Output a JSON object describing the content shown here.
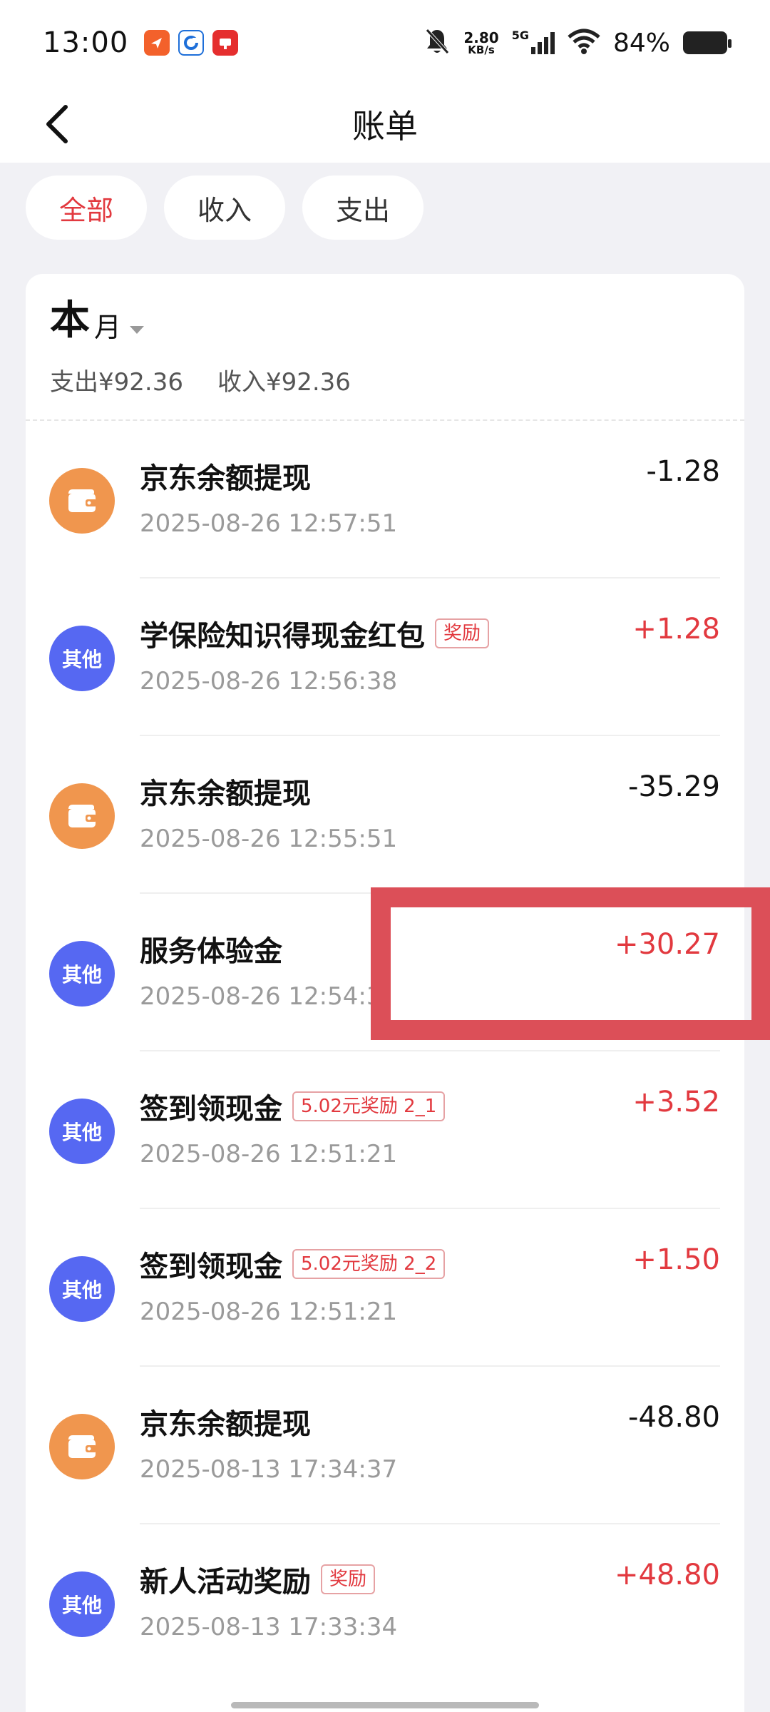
{
  "status_bar": {
    "time": "13:00",
    "net_speed_value": "2.80",
    "net_speed_unit": "KB/s",
    "signal_label": "5G",
    "battery_percent": "84%",
    "battery_level": 0.84,
    "icons": [
      "app-badge-orange",
      "app-badge-blue",
      "app-badge-red",
      "bell-muted-icon",
      "signal-icon",
      "wifi-icon",
      "battery-icon"
    ]
  },
  "header": {
    "title": "账单",
    "back_icon": "chevron-left-icon"
  },
  "filters": {
    "tabs": [
      {
        "label": "全部",
        "active": true
      },
      {
        "label": "收入",
        "active": false
      },
      {
        "label": "支出",
        "active": false
      }
    ]
  },
  "month": {
    "big": "本",
    "small": "月",
    "expense_label": "支出¥92.36",
    "income_label": "收入¥92.36"
  },
  "transactions": [
    {
      "icon": "wallet",
      "icon_text": "",
      "title": "京东余额提现",
      "tag": "",
      "time": "2025-08-26 12:57:51",
      "amount": "-1.28",
      "sign": "neg"
    },
    {
      "icon": "other",
      "icon_text": "其他",
      "title": "学保险知识得现金红包",
      "tag": "奖励",
      "time": "2025-08-26 12:56:38",
      "amount": "+1.28",
      "sign": "pos"
    },
    {
      "icon": "wallet",
      "icon_text": "",
      "title": "京东余额提现",
      "tag": "",
      "time": "2025-08-26 12:55:51",
      "amount": "-35.29",
      "sign": "neg"
    },
    {
      "icon": "other",
      "icon_text": "其他",
      "title": "服务体验金",
      "tag": "",
      "time": "2025-08-26 12:54:3",
      "amount": "+30.27",
      "sign": "pos"
    },
    {
      "icon": "other",
      "icon_text": "其他",
      "title": "签到领现金",
      "tag": "5.02元奖励 2_1",
      "time": "2025-08-26 12:51:21",
      "amount": "+3.52",
      "sign": "pos"
    },
    {
      "icon": "other",
      "icon_text": "其他",
      "title": "签到领现金",
      "tag": "5.02元奖励 2_2",
      "time": "2025-08-26 12:51:21",
      "amount": "+1.50",
      "sign": "pos"
    },
    {
      "icon": "wallet",
      "icon_text": "",
      "title": "京东余额提现",
      "tag": "",
      "time": "2025-08-13 17:34:37",
      "amount": "-48.80",
      "sign": "neg"
    },
    {
      "icon": "other",
      "icon_text": "其他",
      "title": "新人活动奖励",
      "tag": "奖励",
      "time": "2025-08-13 17:33:34",
      "amount": "+48.80",
      "sign": "pos"
    }
  ],
  "colors": {
    "accent_red": "#e2393f",
    "wallet_orange": "#f0964e",
    "other_blue": "#5668f2",
    "highlight": "#dc4f58"
  }
}
